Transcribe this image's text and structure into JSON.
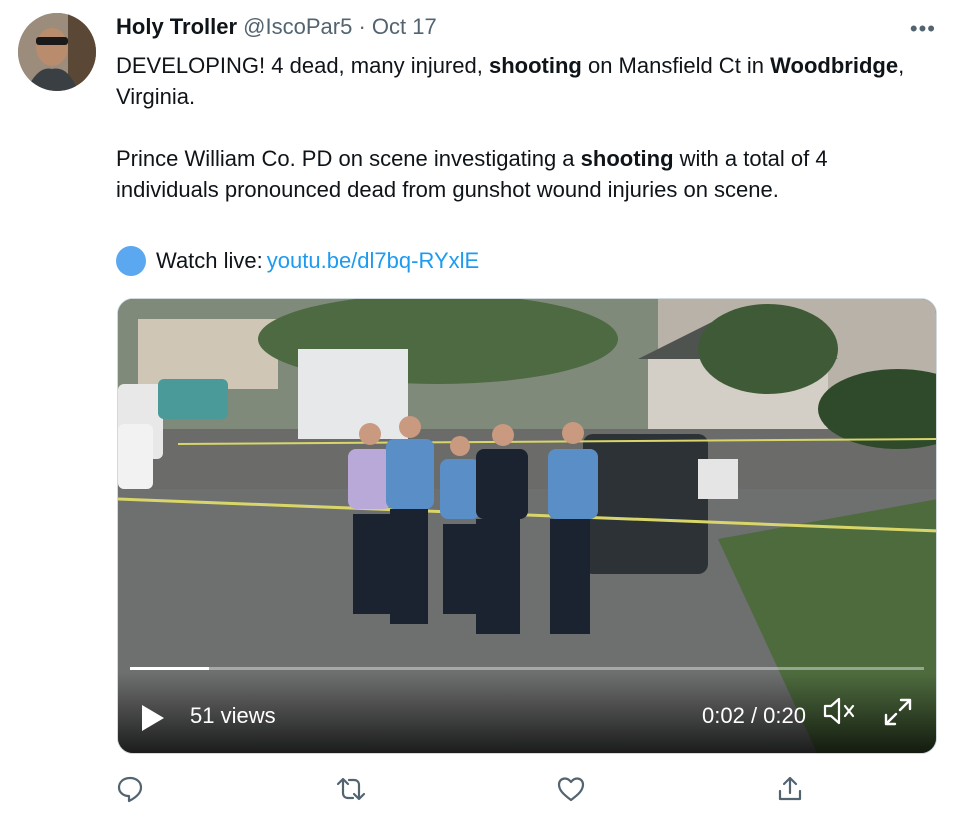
{
  "tweet": {
    "author_name": "Holy Troller",
    "handle": "@IscoPar5",
    "separator": "·",
    "date": "Oct 17",
    "more_label": "•••",
    "para1": [
      {
        "t": "DEVELOPING! 4 dead, many injured, ",
        "b": false
      },
      {
        "t": "shooting",
        "b": true
      },
      {
        "t": " on Mansfield Ct in ",
        "b": false
      },
      {
        "t": "Woodbridge",
        "b": true
      },
      {
        "t": ", Virginia.",
        "b": false
      }
    ],
    "para2": [
      {
        "t": "Prince William Co. PD on scene investigating a ",
        "b": false
      },
      {
        "t": "shooting",
        "b": true
      },
      {
        "t": " with a total of 4 individuals pronounced dead from gunshot wound injuries on scene.",
        "b": false
      }
    ],
    "live_label": "Watch live:",
    "live_link": "youtu.be/dl7bq-RYxlE",
    "live_icon": "blue-circle-icon"
  },
  "video": {
    "views": "51 views",
    "time": "0:02 / 0:20",
    "progress": 0.1,
    "play_icon": "play-icon",
    "mute_icon": "mute-icon",
    "expand_icon": "fullscreen-icon"
  },
  "actions": {
    "reply_icon": "reply-icon",
    "retweet_icon": "retweet-icon",
    "like_icon": "heart-icon",
    "share_icon": "share-icon"
  }
}
